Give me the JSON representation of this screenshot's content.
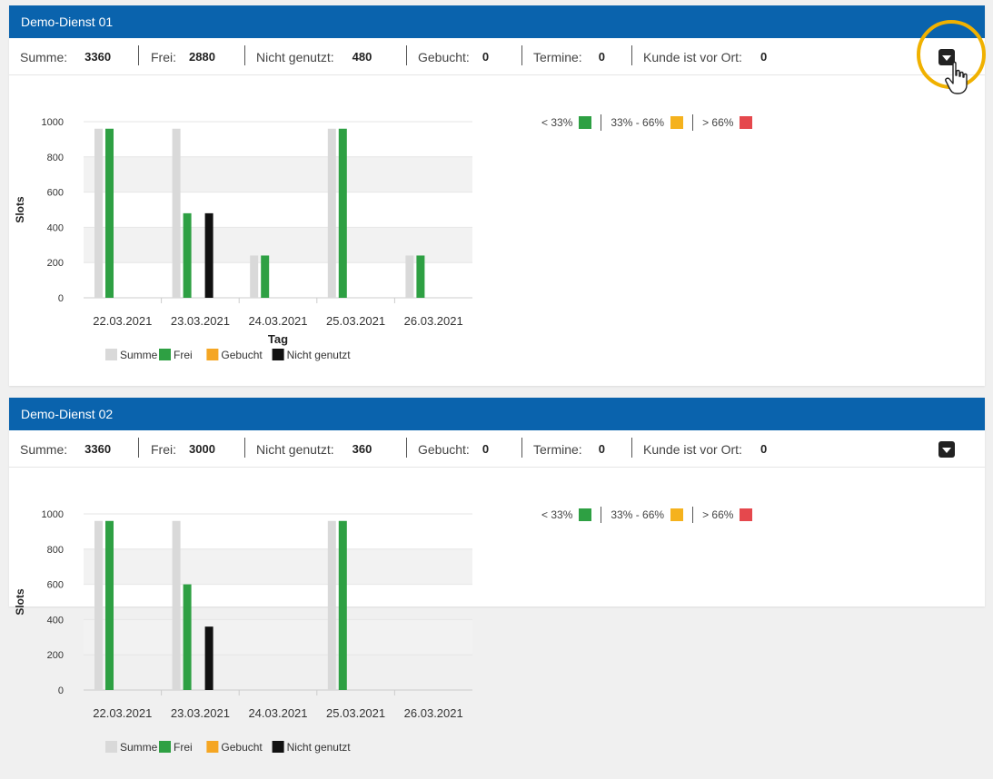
{
  "colors": {
    "header": "#0a63ad",
    "summe": "#d9d9d9",
    "frei": "#2ea043",
    "gebucht": "#f5a623",
    "nicht_genutzt": "#111111",
    "low": "#2ea043",
    "mid": "#f5b21d",
    "high": "#e5484d",
    "highlight": "#f0b100"
  },
  "stat_labels": {
    "summe": "Summe:",
    "frei": "Frei:",
    "nicht_genutzt": "Nicht genutzt:",
    "gebucht": "Gebucht:",
    "termine": "Termine:",
    "kunde": "Kunde ist vor Ort:"
  },
  "legend_right": {
    "low": "< 33%",
    "mid": "33% - 66%",
    "high": "> 66%"
  },
  "panels": [
    {
      "title": "Demo-Dienst 01",
      "stats": {
        "summe": "3360",
        "frei": "2880",
        "nicht_genutzt": "480",
        "gebucht": "0",
        "termine": "0",
        "kunde": "0"
      }
    },
    {
      "title": "Demo-Dienst 02",
      "stats": {
        "summe": "3360",
        "frei": "3000",
        "nicht_genutzt": "360",
        "gebucht": "0",
        "termine": "0",
        "kunde": "0"
      }
    }
  ],
  "chart_data": [
    {
      "type": "bar",
      "xlabel": "Tag",
      "ylabel": "Slots",
      "ylim": [
        0,
        1000
      ],
      "yticks": [
        0,
        200,
        400,
        600,
        800,
        1000
      ],
      "categories": [
        "22.03.2021",
        "23.03.2021",
        "24.03.2021",
        "25.03.2021",
        "26.03.2021"
      ],
      "series": [
        {
          "name": "Summe",
          "values": [
            960,
            960,
            240,
            960,
            240
          ]
        },
        {
          "name": "Frei",
          "values": [
            960,
            480,
            240,
            960,
            240
          ]
        },
        {
          "name": "Gebucht",
          "values": [
            0,
            0,
            0,
            0,
            0
          ]
        },
        {
          "name": "Nicht genutzt",
          "values": [
            0,
            480,
            0,
            0,
            0
          ]
        }
      ],
      "legend": "bottom"
    },
    {
      "type": "bar",
      "xlabel": "",
      "ylabel": "Slots",
      "ylim": [
        0,
        1000
      ],
      "yticks": [
        0,
        200,
        400,
        600,
        800,
        1000
      ],
      "categories": [
        "22.03.2021",
        "23.03.2021",
        "24.03.2021",
        "25.03.2021",
        "26.03.2021"
      ],
      "series": [
        {
          "name": "Summe",
          "values": [
            960,
            960,
            0,
            960,
            0
          ]
        },
        {
          "name": "Frei",
          "values": [
            960,
            600,
            0,
            960,
            0
          ]
        },
        {
          "name": "Gebucht",
          "values": [
            0,
            0,
            0,
            0,
            0
          ]
        },
        {
          "name": "Nicht genutzt",
          "values": [
            0,
            360,
            0,
            0,
            0
          ]
        }
      ],
      "legend": "bottom"
    }
  ]
}
